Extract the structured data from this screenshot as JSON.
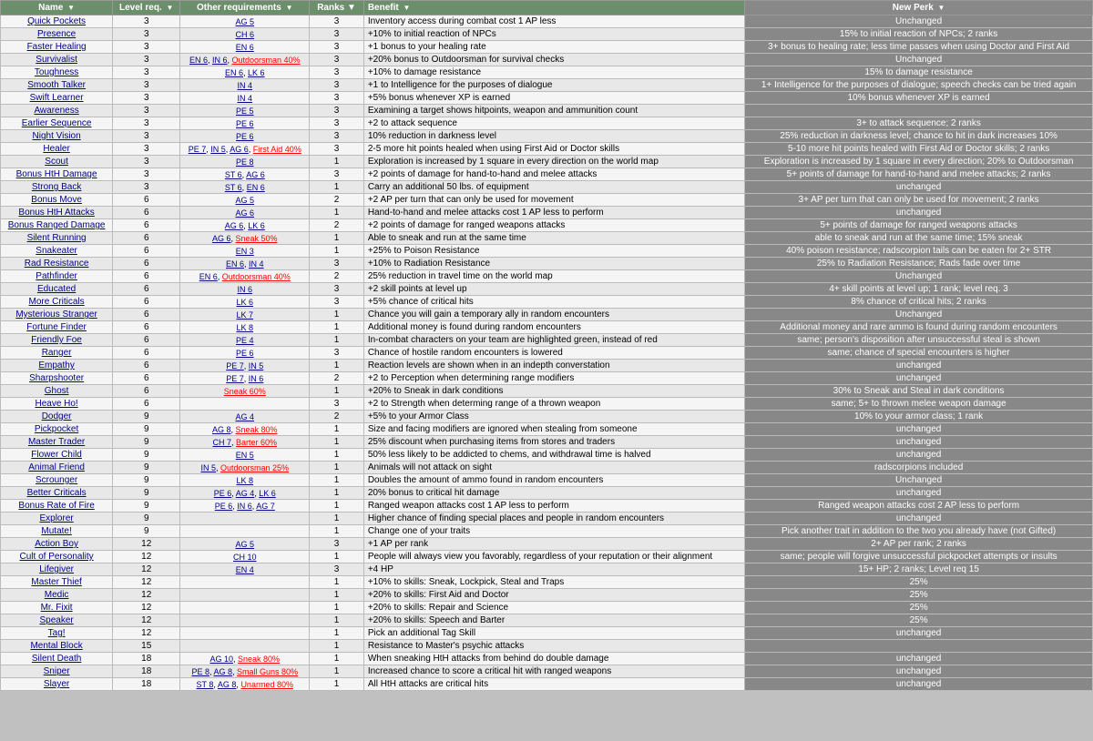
{
  "headers": {
    "name": "Name",
    "level": "Level req.",
    "other": "Other requirements",
    "ranks": "Ranks ▼",
    "benefit": "Benefit",
    "newperk": "New Perk"
  },
  "rows": [
    {
      "name": "Quick Pockets",
      "level": "3",
      "other": "AG 5",
      "ranks": "3",
      "benefit": "Inventory access during combat cost 1 AP less",
      "newperk": "Unchanged"
    },
    {
      "name": "Presence",
      "level": "3",
      "other": "CH 6",
      "ranks": "3",
      "benefit": "+10% to initial reaction of NPCs",
      "newperk": "15% to initial reaction of NPCs; 2 ranks"
    },
    {
      "name": "Faster Healing",
      "level": "3",
      "other": "EN 6",
      "ranks": "3",
      "benefit": "+1 bonus to your healing rate",
      "newperk": "3+ bonus to healing rate; less time passes when using Doctor and First Aid"
    },
    {
      "name": "Survivalist",
      "level": "3",
      "other": "EN 6, IN 6, Outdoorsman 40%",
      "ranks": "3",
      "benefit": "+20% bonus to Outdoorsman for survival checks",
      "newperk": "Unchanged"
    },
    {
      "name": "Toughness",
      "level": "3",
      "other": "EN 6, LK 6",
      "ranks": "3",
      "benefit": "+10% to damage resistance",
      "newperk": "15% to damage resistance"
    },
    {
      "name": "Smooth Talker",
      "level": "3",
      "other": "IN 4",
      "ranks": "3",
      "benefit": "+1 to Intelligence for the purposes of dialogue",
      "newperk": "1+ Intelligence for the purposes of dialogue; speech checks can be tried again"
    },
    {
      "name": "Swift Learner",
      "level": "3",
      "other": "IN 4",
      "ranks": "3",
      "benefit": "+5% bonus whenever XP is earned",
      "newperk": "10% bonus whenever XP is earned"
    },
    {
      "name": "Awareness",
      "level": "3",
      "other": "PE 5",
      "ranks": "3",
      "benefit": "Examining a target shows hitpoints, weapon and ammunition count",
      "newperk": ""
    },
    {
      "name": "Earlier Sequence",
      "level": "3",
      "other": "PE 6",
      "ranks": "3",
      "benefit": "+2 to attack sequence",
      "newperk": "3+ to attack sequence; 2 ranks"
    },
    {
      "name": "Night Vision",
      "level": "3",
      "other": "PE 6",
      "ranks": "3",
      "benefit": "10% reduction in darkness level",
      "newperk": "25% reduction in darkness level; chance to hit in dark increases 10%"
    },
    {
      "name": "Healer",
      "level": "3",
      "other": "PE 7, IN 5, AG 6, First Aid 40%",
      "ranks": "3",
      "benefit": "2-5 more hit points healed when using First Aid or Doctor skills",
      "newperk": "5-10 more hit points healed with First Aid or Doctor skills; 2 ranks"
    },
    {
      "name": "Scout",
      "level": "3",
      "other": "PE 8",
      "ranks": "1",
      "benefit": "Exploration is increased by 1 square in every direction on the world map",
      "newperk": "Exploration is increased by 1 square in every direction; 20% to Outdoorsman"
    },
    {
      "name": "Bonus HtH Damage",
      "level": "3",
      "other": "ST 6, AG 6",
      "ranks": "3",
      "benefit": "+2 points of damage for hand-to-hand and melee attacks",
      "newperk": "5+ points of damage for hand-to-hand and melee attacks; 2 ranks"
    },
    {
      "name": "Strong Back",
      "level": "3",
      "other": "ST 6, EN 6",
      "ranks": "1",
      "benefit": "Carry an additional 50 lbs. of equipment",
      "newperk": "unchanged"
    },
    {
      "name": "Bonus Move",
      "level": "6",
      "other": "AG 5",
      "ranks": "2",
      "benefit": "+2 AP per turn that can only be used for movement",
      "newperk": "3+ AP per turn that can only be used for movement; 2 ranks"
    },
    {
      "name": "Bonus HtH Attacks",
      "level": "6",
      "other": "AG 6",
      "ranks": "1",
      "benefit": "Hand-to-hand and melee attacks cost 1 AP less to perform",
      "newperk": "unchanged"
    },
    {
      "name": "Bonus Ranged Damage",
      "level": "6",
      "other": "AG 6, LK 6",
      "ranks": "2",
      "benefit": "+2 points of damage for ranged weapons attacks",
      "newperk": "5+ points of damage for ranged weapons attacks"
    },
    {
      "name": "Silent Running",
      "level": "6",
      "other": "AG 6, Sneak 50%",
      "ranks": "1",
      "benefit": "Able to sneak and run at the same time",
      "newperk": "able to sneak and run at the same time; 15% sneak"
    },
    {
      "name": "Snakeater",
      "level": "6",
      "other": "EN 3",
      "ranks": "1",
      "benefit": "+25% to Poison Resistance",
      "newperk": "40% poison resistance; radscorpion tails can be eaten for 2+ STR"
    },
    {
      "name": "Rad Resistance",
      "level": "6",
      "other": "EN 6, IN 4",
      "ranks": "3",
      "benefit": "+10% to Radiation Resistance",
      "newperk": "25% to Radiation Resistance; Rads fade over time"
    },
    {
      "name": "Pathfinder",
      "level": "6",
      "other": "EN 6, Outdoorsman 40%",
      "ranks": "2",
      "benefit": "25% reduction in travel time on the world map",
      "newperk": "Unchanged"
    },
    {
      "name": "Educated",
      "level": "6",
      "other": "IN 6",
      "ranks": "3",
      "benefit": "+2 skill points at level up",
      "newperk": "4+ skill points at level up; 1 rank; level req. 3"
    },
    {
      "name": "More Criticals",
      "level": "6",
      "other": "LK 6",
      "ranks": "3",
      "benefit": "+5% chance of critical hits",
      "newperk": "8% chance of critical hits; 2 ranks"
    },
    {
      "name": "Mysterious Stranger",
      "level": "6",
      "other": "LK 7",
      "ranks": "1",
      "benefit": "Chance you will gain a temporary ally in random encounters",
      "newperk": "Unchanged"
    },
    {
      "name": "Fortune Finder",
      "level": "6",
      "other": "LK 8",
      "ranks": "1",
      "benefit": "Additional money is found during random encounters",
      "newperk": "Additional money and rare ammo is found during random encounters"
    },
    {
      "name": "Friendly Foe",
      "level": "6",
      "other": "PE 4",
      "ranks": "1",
      "benefit": "In-combat characters on your team are highlighted green, instead of red",
      "newperk": "same; person's disposition after unsuccessful steal is shown"
    },
    {
      "name": "Ranger",
      "level": "6",
      "other": "PE 6",
      "ranks": "3",
      "benefit": "Chance of hostile random encounters is lowered",
      "newperk": "same; chance of special encounters is higher"
    },
    {
      "name": "Empathy",
      "level": "6",
      "other": "PE 7, IN 5",
      "ranks": "1",
      "benefit": "Reaction levels are shown when in an indepth converstation",
      "newperk": "unchanged"
    },
    {
      "name": "Sharpshooter",
      "level": "6",
      "other": "PE 7, IN 6",
      "ranks": "2",
      "benefit": "+2 to Perception when determining range modifiers",
      "newperk": "unchanged"
    },
    {
      "name": "Ghost",
      "level": "6",
      "other": "Sneak 60%",
      "ranks": "1",
      "benefit": "+20% to Sneak in dark conditions",
      "newperk": "30% to Sneak and Steal in dark conditions"
    },
    {
      "name": "Heave Ho!",
      "level": "6",
      "other": "",
      "ranks": "3",
      "benefit": "+2 to Strength when determing range of a thrown weapon",
      "newperk": "same; 5+ to thrown melee weapon damage"
    },
    {
      "name": "Dodger",
      "level": "9",
      "other": "AG 4",
      "ranks": "2",
      "benefit": "+5% to your Armor Class",
      "newperk": "10% to your armor class; 1 rank"
    },
    {
      "name": "Pickpocket",
      "level": "9",
      "other": "AG 8, Sneak 80%",
      "ranks": "1",
      "benefit": "Size and facing modifiers are ignored when stealing from someone",
      "newperk": "unchanged"
    },
    {
      "name": "Master Trader",
      "level": "9",
      "other": "CH 7, Barter 60%",
      "ranks": "1",
      "benefit": "25% discount when purchasing items from stores and traders",
      "newperk": "unchanged"
    },
    {
      "name": "Flower Child",
      "level": "9",
      "other": "EN 5",
      "ranks": "1",
      "benefit": "50% less likely to be addicted to chems, and withdrawal time is halved",
      "newperk": "unchanged"
    },
    {
      "name": "Animal Friend",
      "level": "9",
      "other": "IN 5, Outdoorsman 25%",
      "ranks": "1",
      "benefit": "Animals will not attack on sight",
      "newperk": "radscorpions included"
    },
    {
      "name": "Scrounger",
      "level": "9",
      "other": "LK 8",
      "ranks": "1",
      "benefit": "Doubles the amount of ammo found in random encounters",
      "newperk": "Unchanged"
    },
    {
      "name": "Better Criticals",
      "level": "9",
      "other": "PE 6, AG 4, LK 6",
      "ranks": "1",
      "benefit": "20% bonus to critical hit damage",
      "newperk": "unchanged"
    },
    {
      "name": "Bonus Rate of Fire",
      "level": "9",
      "other": "PE 6, IN 6, AG 7",
      "ranks": "1",
      "benefit": "Ranged weapon attacks cost 1 AP less to perform",
      "newperk": "Ranged weapon attacks cost 2 AP less to perform"
    },
    {
      "name": "Explorer",
      "level": "9",
      "other": "",
      "ranks": "1",
      "benefit": "Higher chance of finding special places and people in random encounters",
      "newperk": "unchanged"
    },
    {
      "name": "Mutate!",
      "level": "9",
      "other": "",
      "ranks": "1",
      "benefit": "Change one of your traits",
      "newperk": "Pick another trait in addition to the two you already have (not Gifted)"
    },
    {
      "name": "Action Boy",
      "level": "12",
      "other": "AG 5",
      "ranks": "3",
      "benefit": "+1 AP per rank",
      "newperk": "2+ AP per rank; 2 ranks"
    },
    {
      "name": "Cult of Personality",
      "level": "12",
      "other": "CH 10",
      "ranks": "1",
      "benefit": "People will always view you favorably, regardless of your reputation or their alignment",
      "newperk": "same; people will forgive unsuccessful pickpocket attempts or insults"
    },
    {
      "name": "Lifegiver",
      "level": "12",
      "other": "EN 4",
      "ranks": "3",
      "benefit": "+4 HP",
      "newperk": "15+ HP; 2 ranks; Level req 15"
    },
    {
      "name": "Master Thief",
      "level": "12",
      "other": "",
      "ranks": "1",
      "benefit": "+10% to skills: Sneak, Lockpick, Steal and Traps",
      "newperk": "25%"
    },
    {
      "name": "Medic",
      "level": "12",
      "other": "",
      "ranks": "1",
      "benefit": "+20% to skills: First Aid and Doctor",
      "newperk": "25%"
    },
    {
      "name": "Mr. Fixit",
      "level": "12",
      "other": "",
      "ranks": "1",
      "benefit": "+20% to skills: Repair and Science",
      "newperk": "25%"
    },
    {
      "name": "Speaker",
      "level": "12",
      "other": "",
      "ranks": "1",
      "benefit": "+20% to skills: Speech and Barter",
      "newperk": "25%"
    },
    {
      "name": "Tag!",
      "level": "12",
      "other": "",
      "ranks": "1",
      "benefit": "Pick an additional Tag Skill",
      "newperk": "unchanged"
    },
    {
      "name": "Mental Block",
      "level": "15",
      "other": "",
      "ranks": "1",
      "benefit": "Resistance to Master's psychic attacks",
      "newperk": ""
    },
    {
      "name": "Silent Death",
      "level": "18",
      "other": "AG 10, Sneak 80%",
      "ranks": "1",
      "benefit": "When sneaking HtH attacks from behind do double damage",
      "newperk": "unchanged"
    },
    {
      "name": "Sniper",
      "level": "18",
      "other": "PE 8, AG 8, Small Guns 80%",
      "ranks": "1",
      "benefit": "Increased chance to score a critical hit with ranged weapons",
      "newperk": "unchanged"
    },
    {
      "name": "Slayer",
      "level": "18",
      "other": "ST 8, AG 8, Unarmed 80%",
      "ranks": "1",
      "benefit": "All HtH attacks are critical hits",
      "newperk": "unchanged"
    }
  ]
}
